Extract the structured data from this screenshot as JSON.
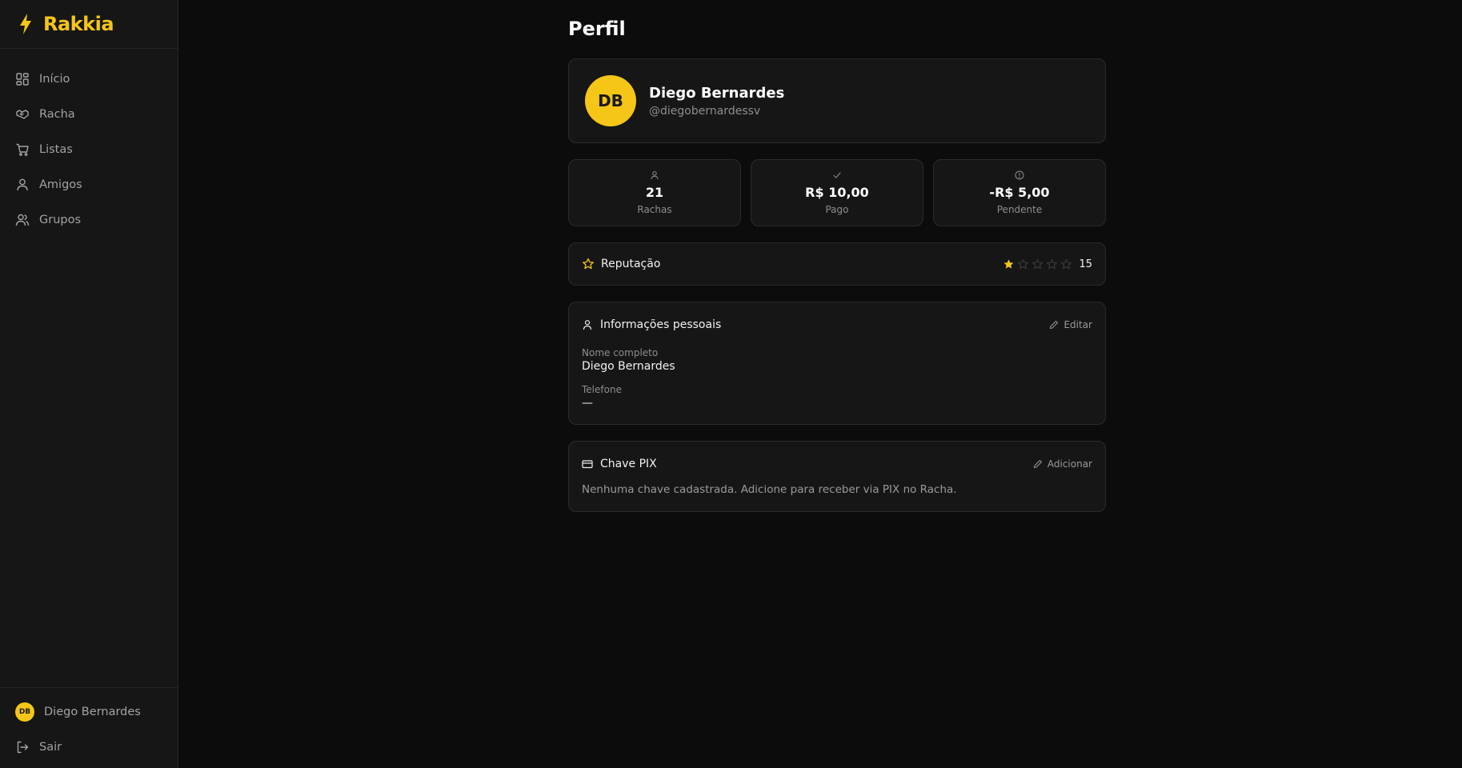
{
  "brand": {
    "name": "Rakkia",
    "color": "#f5c518"
  },
  "nav": {
    "items": [
      {
        "label": "Início",
        "icon": "grid-icon"
      },
      {
        "label": "Racha",
        "icon": "handshake-icon"
      },
      {
        "label": "Listas",
        "icon": "cart-icon"
      },
      {
        "label": "Amigos",
        "icon": "user-icon"
      },
      {
        "label": "Grupos",
        "icon": "users-icon"
      }
    ]
  },
  "sidebar_user": {
    "initials": "DB",
    "name": "Diego Bernardes"
  },
  "logout": {
    "label": "Sair",
    "icon": "logout-icon"
  },
  "page": {
    "title": "Perfil"
  },
  "profile": {
    "initials": "DB",
    "name": "Diego Bernardes",
    "handle": "@diegobernardessv"
  },
  "stats": [
    {
      "icon": "user-icon",
      "value": "21",
      "label": "Rachas"
    },
    {
      "icon": "check-icon",
      "value": "R$ 10,00",
      "label": "Pago"
    },
    {
      "icon": "alert-circle-icon",
      "value": "-R$ 5,00",
      "label": "Pendente"
    }
  ],
  "reputation": {
    "title": "Reputação",
    "rating": 1,
    "max_rating": 5,
    "count": "15"
  },
  "personal_info": {
    "title": "Informações pessoais",
    "edit_label": "Editar",
    "fields": [
      {
        "label": "Nome completo",
        "value": "Diego Bernardes"
      },
      {
        "label": "Telefone",
        "value": "—"
      }
    ]
  },
  "pix": {
    "title": "Chave PIX",
    "add_label": "Adicionar",
    "empty_text": "Nenhuma chave cadastrada. Adicione para receber via PIX no Racha."
  },
  "colors": {
    "accent": "#f5c518",
    "background": "#0c0c0c",
    "card": "#161616",
    "muted_text": "#8e8e8e"
  }
}
